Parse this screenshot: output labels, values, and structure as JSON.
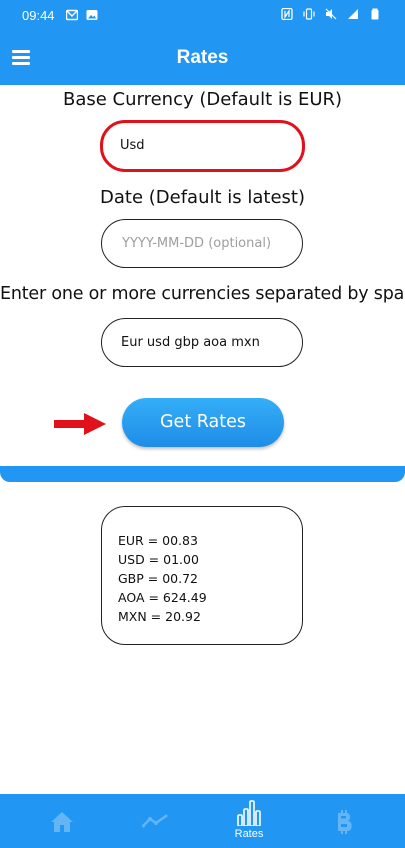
{
  "status_bar": {
    "time": "09:44",
    "icons_left": [
      "gmail-icon",
      "image-icon"
    ],
    "icons_right": [
      "nfc-icon",
      "vibrate-icon",
      "mute-icon",
      "signal-icon",
      "battery-icon"
    ],
    "background": "#2196f3"
  },
  "app_bar": {
    "title": "Rates",
    "menu_icon": "hamburger-menu-icon",
    "background": "#2196f3"
  },
  "form": {
    "base_currency_label": "Base Currency (Default is EUR)",
    "base_currency_value": "Usd",
    "date_label": "Date (Default is latest)",
    "date_placeholder": "YYYY-MM-DD (optional)",
    "currencies_label": "Enter one or more currencies separated by space",
    "currencies_value": "Eur usd gbp aoa mxn",
    "submit_label": "Get Rates",
    "highlight_color": "#e0111a"
  },
  "results": {
    "lines": [
      "EUR = 00.83",
      "USD = 01.00",
      "GBP = 00.72",
      "AOA = 624.49",
      "MXN = 20.92"
    ]
  },
  "bottom_nav": {
    "items": [
      {
        "icon": "home-icon",
        "label": ""
      },
      {
        "icon": "trending-icon",
        "label": ""
      },
      {
        "icon": "bar-chart-icon",
        "label": "Rates",
        "active": true
      },
      {
        "icon": "bitcoin-icon",
        "label": ""
      }
    ],
    "background": "#2196f3"
  }
}
